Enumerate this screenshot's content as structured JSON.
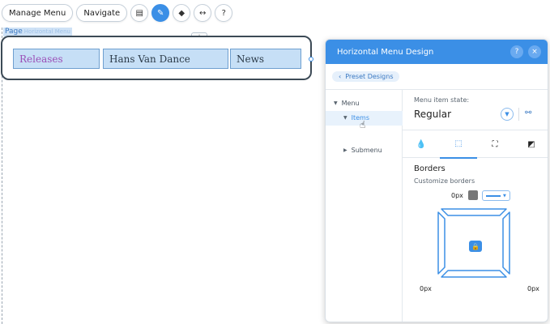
{
  "toolbar": {
    "manage_menu": "Manage Menu",
    "navigate": "Navigate",
    "icons": [
      "layout-icon",
      "pen-icon",
      "animation-icon",
      "stretch-icon",
      "help-icon"
    ]
  },
  "page": {
    "label": "Page",
    "sublabel": "Horizontal Menu"
  },
  "menu": {
    "items": [
      {
        "label": "Releases",
        "active": true
      },
      {
        "label": "Hans Van Dance",
        "active": false
      },
      {
        "label": "News",
        "active": false
      }
    ],
    "active_color": "#9b4fb7",
    "item_bg": "#c6dff6"
  },
  "panel": {
    "title": "Horizontal Menu Design",
    "help": "?",
    "close": "×",
    "preset_label": "Preset Designs",
    "tree": {
      "menu": "Menu",
      "items": "Items",
      "submenu": "Submenu"
    },
    "state_label": "Menu item state:",
    "state_value": "Regular",
    "tabs": [
      "fill-icon",
      "border-icon",
      "corners-icon",
      "shadow-icon"
    ],
    "borders_title": "Borders",
    "borders_sub": "Customize borders",
    "top_px": "0px",
    "left_px": "0px",
    "right_px": "0px",
    "bottom_px": "0px",
    "accent": "#3b8fe6",
    "swatch_color": "#777777"
  }
}
